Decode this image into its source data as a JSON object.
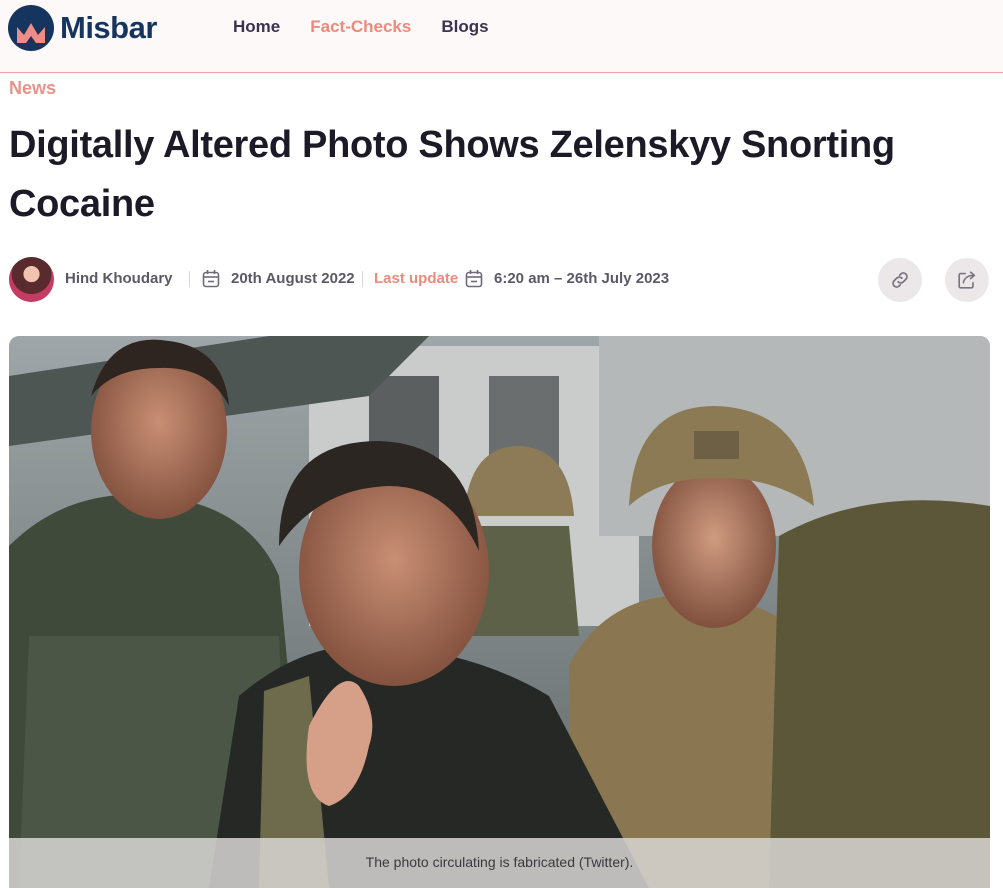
{
  "brand": {
    "name": "Misbar",
    "color": "#16355e"
  },
  "nav": {
    "items": [
      {
        "label": "Home"
      },
      {
        "label": "Fact-Checks"
      },
      {
        "label": "Blogs"
      }
    ],
    "active_color": "#ec8a7c"
  },
  "article": {
    "category": "News",
    "title": "Digitally Altered Photo Shows Zelenskyy Snorting Cocaine",
    "author": "Hind Khoudary",
    "published": "20th August 2022",
    "last_update_label": "Last update",
    "last_update": "6:20 am – 26th July 2023",
    "image_caption": "The photo circulating is fabricated (Twitter)."
  },
  "actions": {
    "copy_link_icon": "link-icon",
    "share_icon": "share-icon"
  }
}
